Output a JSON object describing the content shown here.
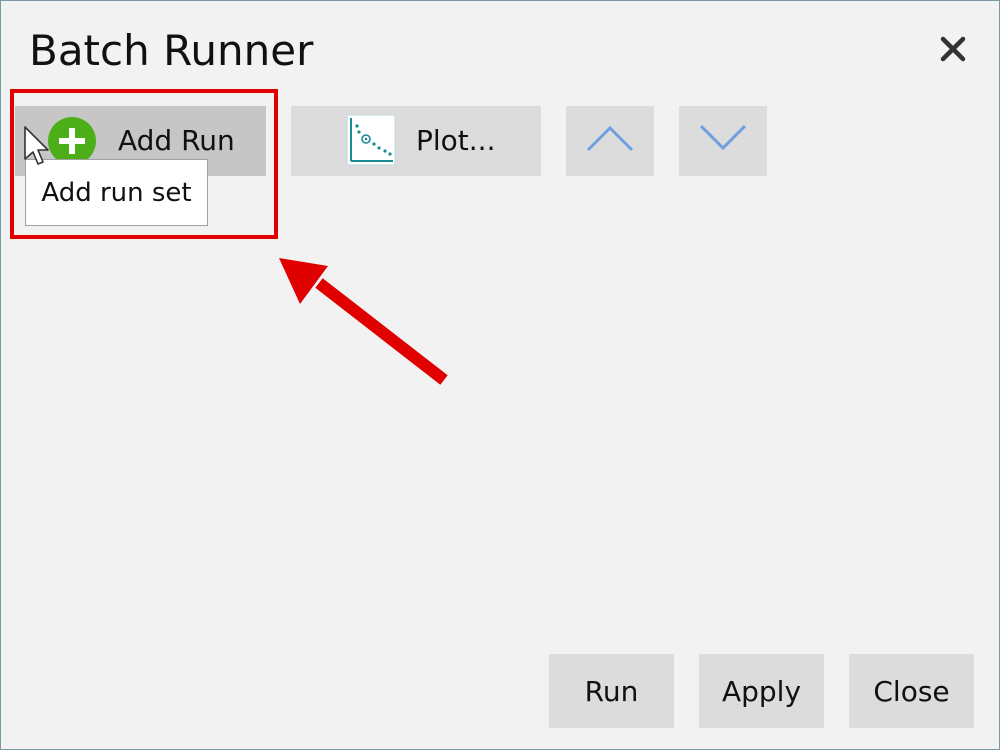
{
  "window": {
    "title": "Batch Runner",
    "close_icon": "close-x-icon"
  },
  "toolbar": {
    "add_run_label": "Add Run",
    "add_run_icon": "plus-circle-icon",
    "plot_label": "Plot...",
    "plot_icon": "plot-chart-icon",
    "move_up_icon": "chevron-up-icon",
    "move_down_icon": "chevron-down-icon"
  },
  "tooltip": {
    "text": "Add run set"
  },
  "footer": {
    "run_label": "Run",
    "apply_label": "Apply",
    "close_label": "Close"
  },
  "annotation": {
    "highlight_color": "#e00000",
    "arrow_color": "#e00000"
  },
  "colors": {
    "accent_green": "#4caf1a",
    "chevron_blue": "#6f9fe0",
    "plot_teal": "#1a8a94"
  }
}
